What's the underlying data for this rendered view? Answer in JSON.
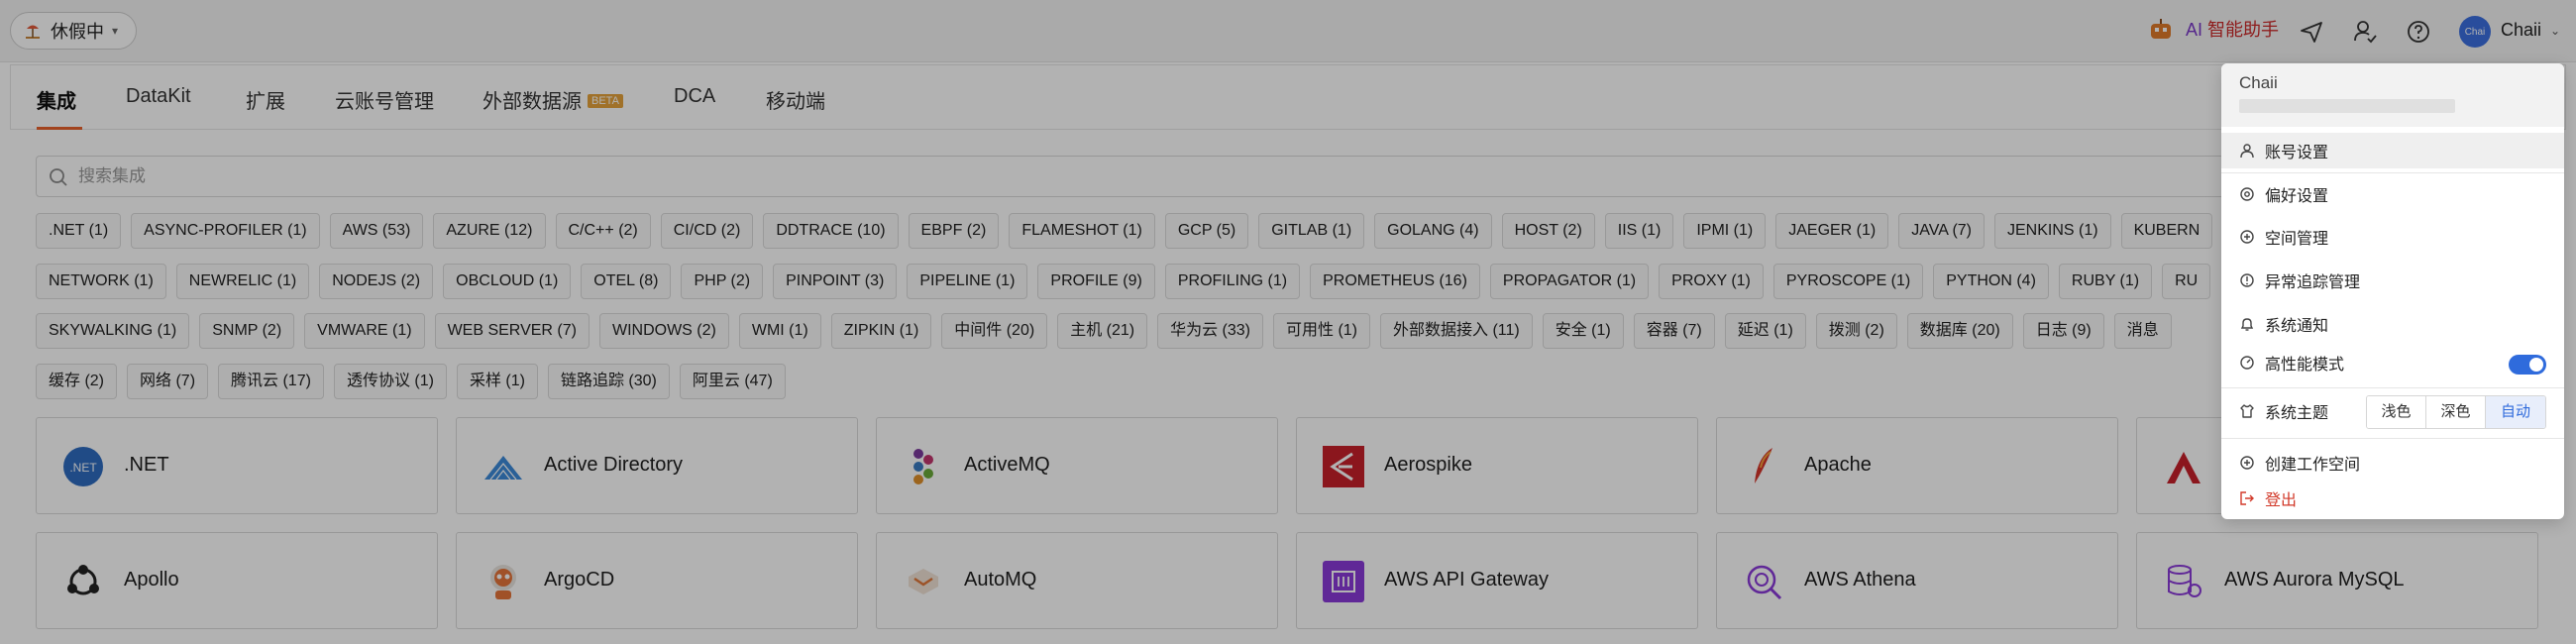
{
  "topbar": {
    "status_label": "休假中",
    "ai_prefix": "AI",
    "ai_label": "智能助手",
    "avatar_text": "Chai",
    "user_name": "Chaii"
  },
  "tabs": [
    "集成",
    "DataKit",
    "扩展",
    "云账号管理",
    "外部数据源",
    "DCA",
    "移动端"
  ],
  "beta_badge": "BETA",
  "search": {
    "placeholder": "搜索集成"
  },
  "tag_rows": [
    [
      ".NET (1)",
      "ASYNC-PROFILER (1)",
      "AWS (53)",
      "AZURE (12)",
      "C/C++ (2)",
      "CI/CD (2)",
      "DDTRACE (10)",
      "EBPF (2)",
      "FLAMESHOT (1)",
      "GCP (5)",
      "GITLAB (1)",
      "GOLANG (4)",
      "HOST (2)",
      "IIS (1)",
      "IPMI (1)",
      "JAEGER (1)",
      "JAVA (7)",
      "JENKINS (1)",
      "KUBERN"
    ],
    [
      "NETWORK (1)",
      "NEWRELIC (1)",
      "NODEJS (2)",
      "OBCLOUD (1)",
      "OTEL (8)",
      "PHP (2)",
      "PINPOINT (3)",
      "PIPELINE (1)",
      "PROFILE (9)",
      "PROFILING (1)",
      "PROMETHEUS (16)",
      "PROPAGATOR (1)",
      "PROXY (1)",
      "PYROSCOPE (1)",
      "PYTHON (4)",
      "RUBY (1)",
      "RU"
    ],
    [
      "SKYWALKING (1)",
      "SNMP (2)",
      "VMWARE (1)",
      "WEB SERVER (7)",
      "WINDOWS (2)",
      "WMI (1)",
      "ZIPKIN (1)",
      "中间件 (20)",
      "主机 (21)",
      "华为云 (33)",
      "可用性 (1)",
      "外部数据接入 (11)",
      "安全 (1)",
      "容器 (7)",
      "延迟 (1)",
      "拨测 (2)",
      "数据库 (20)",
      "日志 (9)",
      "消息"
    ],
    [
      "缓存 (2)",
      "网络 (7)",
      "腾讯云 (17)",
      "透传协议 (1)",
      "采样 (1)",
      "链路追踪 (30)",
      "阿里云 (47)"
    ]
  ],
  "cards_row1": [
    ".NET",
    "Active Directory",
    "ActiveMQ",
    "Aerospike",
    "Apache",
    ""
  ],
  "cards_row2": [
    "Apollo",
    "ArgoCD",
    "AutoMQ",
    "AWS API Gateway",
    "AWS Athena",
    "AWS Aurora MySQL"
  ],
  "user_menu": {
    "name": "Chaii",
    "items": [
      "账号设置",
      "偏好设置",
      "空间管理",
      "异常追踪管理",
      "系统通知",
      "高性能模式",
      "系统主题",
      "创建工作空间",
      "登出"
    ],
    "theme_options": [
      "浅色",
      "深色",
      "自动"
    ],
    "high_perf_on": true,
    "accent_color": "#2f6bdc"
  },
  "colors": {
    "tab_accent": "#e8612c",
    "logout_red": "#d23a2a"
  }
}
